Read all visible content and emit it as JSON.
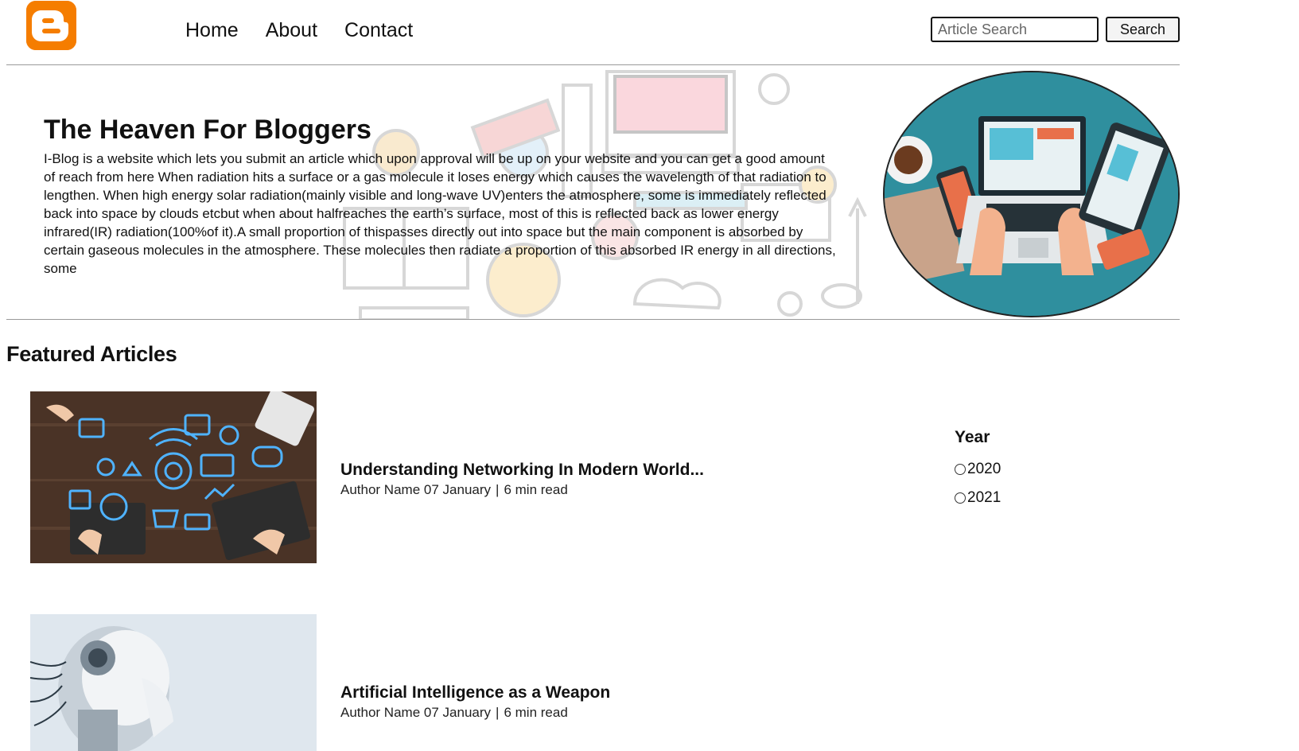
{
  "header": {
    "logo_icon": "blogger-logo-icon",
    "nav": [
      "Home",
      "About",
      "Contact"
    ],
    "search_placeholder": "Article Search",
    "search_button": "Search"
  },
  "hero": {
    "title": "The Heaven For Bloggers",
    "text": "I-Blog is a website which lets you submit an article which upon approval will be up on your website and you can get a good amount of reach from here When radiation hits a surface or a gas molecule it loses energy which causes the wavelength of that radiation to lengthen. When high energy solar radiation(mainly visible and long-wave UV)enters the atmosphere, some is immediately reflected back into space by clouds etcbut when about halfreaches the earth’s surface, most of this is reflected back as lower energy infrared(IR) radiation(100%of it).A small proportion of thispasses directly out into space but the main component is absorbed by certain gaseous molecules in the atmosphere. These molecules then radiate a proportion of this absorbed IR energy in all directions, some",
    "image_icon": "laptop-workspace-illustration"
  },
  "featured": {
    "heading": "Featured Articles",
    "articles": [
      {
        "title": "Understanding Networking In Modern World...",
        "author": "Author Name",
        "date": "07 January",
        "separator": "|",
        "read_time": "6 min read"
      },
      {
        "title": "Artificial Intelligence as a Weapon",
        "author": "Author Name",
        "date": "07 January",
        "separator": "|",
        "read_time": "6 min read"
      }
    ]
  },
  "filter": {
    "title": "Year",
    "options": [
      "2020",
      "2021"
    ]
  },
  "colors": {
    "logo": "#f57d00",
    "hero_circle": "#2f8f9e"
  }
}
